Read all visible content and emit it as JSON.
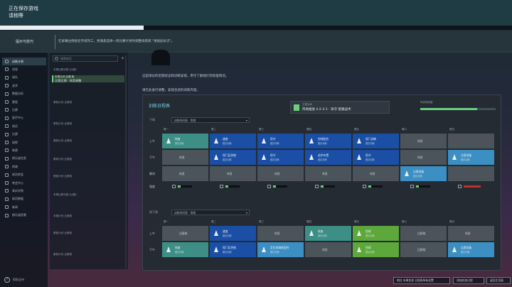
{
  "topbar": {
    "line1": "正在保存游戏",
    "line2": "请稍等",
    "progress": 0.28
  },
  "tipbar": {
    "label": "提示与技巧",
    "text": "在屏幕左侧按名字排列工，更满意选择一周比赛计划时调整排疾病 \"请按此标识\"。"
  },
  "sidebar": {
    "items": [
      {
        "label": "训练计划",
        "active": true
      },
      {
        "label": "消息",
        "active": false
      },
      {
        "label": "球队",
        "active": false
      },
      {
        "label": "战术",
        "active": false
      },
      {
        "label": "数据分析",
        "active": false
      },
      {
        "label": "赛程",
        "active": false
      },
      {
        "label": "比赛",
        "active": false
      },
      {
        "label": "医疗中心",
        "active": false
      },
      {
        "label": "球员",
        "active": false
      },
      {
        "label": "比赛",
        "active": false
      },
      {
        "label": "球探",
        "active": false
      },
      {
        "label": "联赛",
        "active": false
      },
      {
        "label": "俱乐部信息",
        "active": false
      },
      {
        "label": "财政",
        "active": false
      },
      {
        "label": "球员转会",
        "active": false
      },
      {
        "label": "转会中心",
        "active": false
      },
      {
        "label": "青训学院",
        "active": false
      },
      {
        "label": "球员数据",
        "active": false
      },
      {
        "label": "新闻",
        "active": false
      },
      {
        "label": "俱乐部愿景",
        "active": false
      }
    ],
    "help": "帮助支持"
  },
  "listpanel": {
    "search_placeholder": "搜索球员",
    "items": [
      {
        "title": "本周比赛日程 (比赛)",
        "sub": "",
        "selected": false
      },
      {
        "title": "本周计划 比赛 新",
        "sub": "比赛日期 · 阵容调整",
        "selected": true
      },
      {
        "title": "赛前计划 比赛前",
        "sub": "",
        "selected": false
      },
      {
        "title": "赛前计划 比赛前",
        "sub": "",
        "selected": false
      },
      {
        "title": "赛前计划 比赛前",
        "sub": "",
        "selected": false
      },
      {
        "title": "赛前计划 比赛前",
        "sub": "",
        "selected": false
      },
      {
        "title": "赛前计划 比赛前",
        "sub": "",
        "selected": false
      },
      {
        "title": "本周比赛日程 (比赛)",
        "sub": "",
        "selected": false
      },
      {
        "title": "本周计划 比赛前",
        "sub": "",
        "selected": false
      },
      {
        "title": "赛前计划 比赛前",
        "sub": "",
        "selected": false
      },
      {
        "title": "赛前计划 比赛前",
        "sub": "",
        "selected": false
      }
    ]
  },
  "main": {
    "desc1": "这是球员的近期状态和训练安排，用于了解他们的恢复情况。",
    "desc2": "请在此进行调整，安排合适的训练内容。"
  },
  "card": {
    "title": "训练日程表",
    "formation_label": "主要战术",
    "formation_value": "阵地推进 4-2-3-1 · 攻守 套路战术",
    "bar_label": "阵容熟练度",
    "bar_fill": 0.75,
    "week1": {
      "section": "下周",
      "dropdown": "训练时间表 · 常规",
      "days": [
        "周一",
        "周二",
        "周三",
        "周四",
        "周五",
        "周六",
        "周日"
      ],
      "rows": [
        {
          "label": "上午",
          "cells": [
            {
              "style": "teal",
              "l1": "恢复",
              "l2": "团队训练"
            },
            {
              "style": "blue",
              "l1": "速度",
              "l2": "团队训练"
            },
            {
              "style": "blue",
              "l1": "防守",
              "l2": "团队训练"
            },
            {
              "style": "blue",
              "l1": "控球配合",
              "l2": "团队训练"
            },
            {
              "style": "blue",
              "l1": "保门训练",
              "l2": "团队训练"
            },
            {
              "style": "grey",
              "l1": "休息",
              "l2": ""
            },
            {
              "style": "grey",
              "l1": "",
              "l2": ""
            }
          ]
        },
        {
          "label": "下午",
          "cells": [
            {
              "style": "grey",
              "l1": "休息",
              "l2": ""
            },
            {
              "style": "blue",
              "l1": "保门区控制",
              "l2": "团队训练"
            },
            {
              "style": "blue",
              "l1": "防守",
              "l2": "团队训练"
            },
            {
              "style": "blue",
              "l1": "战术布置",
              "l2": "团队训练"
            },
            {
              "style": "blue",
              "l1": "防守",
              "l2": "团队训练"
            },
            {
              "style": "grey",
              "l1": "休息",
              "l2": ""
            },
            {
              "style": "lblue",
              "l1": "比赛准备",
              "l2": "团队训练"
            }
          ]
        },
        {
          "label": "晚间",
          "cells": [
            {
              "style": "grey",
              "l1": "休息",
              "l2": ""
            },
            {
              "style": "grey",
              "l1": "休息",
              "l2": ""
            },
            {
              "style": "grey",
              "l1": "休息",
              "l2": ""
            },
            {
              "style": "grey",
              "l1": "休息",
              "l2": ""
            },
            {
              "style": "grey",
              "l1": "休息",
              "l2": ""
            },
            {
              "style": "lblue",
              "l1": "比赛准备",
              "l2": "团队训练"
            },
            {
              "style": "grey",
              "l1": "",
              "l2": ""
            }
          ]
        }
      ],
      "intensity_label": "强度"
    },
    "week2": {
      "section": "再下周",
      "dropdown": "训练时间表 · 常规",
      "days": [
        "周一",
        "周二",
        "周三",
        "周四",
        "周五",
        "周六",
        "周日"
      ],
      "rows": [
        {
          "label": "上午",
          "cells": [
            {
              "style": "grey",
              "l1": "比赛前",
              "l2": ""
            },
            {
              "style": "blue",
              "l1": "速度",
              "l2": "团队训练"
            },
            {
              "style": "grey",
              "l1": "休息",
              "l2": ""
            },
            {
              "style": "teal",
              "l1": "恢复",
              "l2": "团队训练"
            },
            {
              "style": "green",
              "l1": "控球",
              "l2": "团队训练"
            },
            {
              "style": "grey",
              "l1": "比赛前",
              "l2": ""
            },
            {
              "style": "grey",
              "l1": "休息",
              "l2": ""
            }
          ]
        },
        {
          "label": "下午",
          "cells": [
            {
              "style": "teal",
              "l1": "恢复",
              "l2": "团队训练"
            },
            {
              "style": "blue",
              "l1": "保门区控制",
              "l2": "团队训练"
            },
            {
              "style": "lblue",
              "l1": "定位球演练配合",
              "l2": "团队训练"
            },
            {
              "style": "grey",
              "l1": "休息",
              "l2": ""
            },
            {
              "style": "green",
              "l1": "控球",
              "l2": "团队训练"
            },
            {
              "style": "grey",
              "l1": "比赛前",
              "l2": ""
            },
            {
              "style": "lblue",
              "l1": "比赛准备",
              "l2": "团队训练"
            }
          ]
        }
      ]
    }
  },
  "buttons": [
    {
      "label": "前往 本周信息 日程表所有设置"
    },
    {
      "label": "添加任务日程"
    },
    {
      "label": "返回主页面"
    }
  ]
}
